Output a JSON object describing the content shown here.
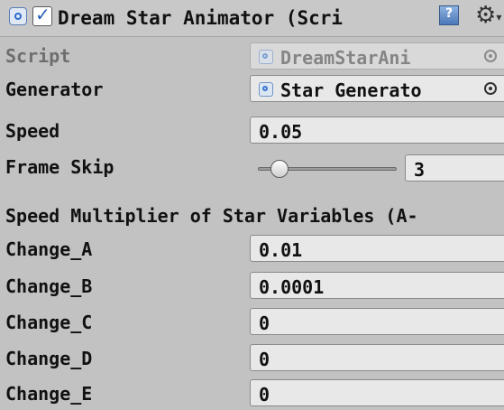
{
  "header": {
    "title": "Dream Star Animator (Scri",
    "enabled": true,
    "component_icon": "script-icon",
    "help_icon": "help-icon",
    "settings_icon": "gear-icon",
    "gear_glyph": "⚙",
    "gear_caret": "▾"
  },
  "fields": {
    "script": {
      "label": "Script",
      "value": "DreamStarAni",
      "icon": "script-file-icon"
    },
    "generator": {
      "label": "Generator",
      "value": "Star Generato",
      "icon": "script-file-icon"
    },
    "speed": {
      "label": "Speed",
      "value": "0.05"
    },
    "frame_skip": {
      "label": "Frame Skip",
      "value": "3",
      "slider_fraction": 0.1
    }
  },
  "section": {
    "title": "Speed Multiplier of Star Variables (A-"
  },
  "changes": [
    {
      "label": "Change_A",
      "value": "0.01"
    },
    {
      "label": "Change_B",
      "value": "0.0001"
    },
    {
      "label": "Change_C",
      "value": "0"
    },
    {
      "label": "Change_D",
      "value": "0"
    },
    {
      "label": "Change_E",
      "value": "0"
    }
  ],
  "colors": {
    "panel_bg": "#c2c2c2",
    "field_bg": "#e8e8e8",
    "accent_blue": "#2f6bd1"
  }
}
